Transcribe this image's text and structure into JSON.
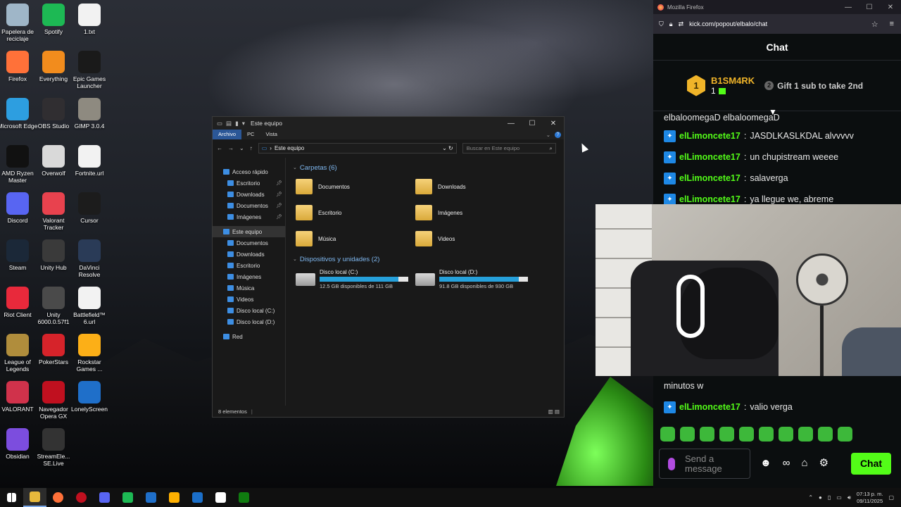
{
  "desktop": {
    "icons": [
      {
        "label": "Papelera de reciclaje",
        "icon": "recycle-bin-icon",
        "color": "#9fb6c8"
      },
      {
        "label": "Spotify",
        "icon": "spotify-icon",
        "color": "#1db954"
      },
      {
        "label": "1.txt",
        "icon": "text-file-icon",
        "color": "#f2f2f2"
      },
      {
        "label": "Firefox",
        "icon": "firefox-icon",
        "color": "#ff7139"
      },
      {
        "label": "Everything",
        "icon": "search-icon",
        "color": "#f28c1d"
      },
      {
        "label": "Epic Games Launcher",
        "icon": "epic-games-icon",
        "color": "#1a1a1a"
      },
      {
        "label": "Microsoft Edge",
        "icon": "edge-icon",
        "color": "#2d9ee0"
      },
      {
        "label": "OBS Studio",
        "icon": "obs-icon",
        "color": "#302e31"
      },
      {
        "label": "GIMP 3.0.4",
        "icon": "gimp-icon",
        "color": "#8e8a80"
      },
      {
        "label": "AMD Ryzen Master",
        "icon": "amd-ryzen-icon",
        "color": "#111111"
      },
      {
        "label": "Overwolf",
        "icon": "overwolf-icon",
        "color": "#d9d9d9"
      },
      {
        "label": "Fortnite.url",
        "icon": "url-file-icon",
        "color": "#f2f2f2"
      },
      {
        "label": "Discord",
        "icon": "discord-icon",
        "color": "#5865f2"
      },
      {
        "label": "Valorant Tracker",
        "icon": "valorant-tracker-icon",
        "color": "#e8424e"
      },
      {
        "label": "Cursor",
        "icon": "cursor-app-icon",
        "color": "#1c1c1c"
      },
      {
        "label": "Steam",
        "icon": "steam-icon",
        "color": "#1b2838"
      },
      {
        "label": "Unity Hub",
        "icon": "unity-hub-icon",
        "color": "#3a3a3a"
      },
      {
        "label": "DaVinci Resolve",
        "icon": "davinci-icon",
        "color": "#2a3b57"
      },
      {
        "label": "Riot Client",
        "icon": "riot-icon",
        "color": "#e8293b"
      },
      {
        "label": "Unity 6000.0.57f1",
        "icon": "unity-icon",
        "color": "#4a4a4a"
      },
      {
        "label": "Battlefield™ 6.url",
        "icon": "url-file-icon",
        "color": "#f2f2f2"
      },
      {
        "label": "League of Legends",
        "icon": "lol-icon",
        "color": "#b08d3c"
      },
      {
        "label": "PokerStars",
        "icon": "pokerstars-icon",
        "color": "#d6232a"
      },
      {
        "label": "Rockstar Games ...",
        "icon": "rockstar-icon",
        "color": "#fcaf17"
      },
      {
        "label": "VALORANT",
        "icon": "valorant-icon",
        "color": "#d0324b"
      },
      {
        "label": "Navegador Opera GX",
        "icon": "opera-gx-icon",
        "color": "#c0101f"
      },
      {
        "label": "LonelyScreen",
        "icon": "lonelyscreen-icon",
        "color": "#1f6fc9"
      },
      {
        "label": "Obsidian",
        "icon": "obsidian-icon",
        "color": "#7c4dde"
      },
      {
        "label": "StreamEle... SE.Live",
        "icon": "streamelements-icon",
        "color": "#333333"
      }
    ]
  },
  "explorer": {
    "title": "Este equipo",
    "ribbon_tabs": [
      "Archivo",
      "PC",
      "Vista"
    ],
    "address": "Este equipo",
    "search_placeholder": "Buscar en Este equipo",
    "nav": [
      {
        "label": "Acceso rápido",
        "level": 0,
        "pinned": false
      },
      {
        "label": "Escritorio",
        "level": 1,
        "pinned": true
      },
      {
        "label": "Downloads",
        "level": 1,
        "pinned": true
      },
      {
        "label": "Documentos",
        "level": 1,
        "pinned": true
      },
      {
        "label": "Imágenes",
        "level": 1,
        "pinned": true
      },
      {
        "label": "Este equipo",
        "level": 0,
        "pinned": false,
        "selected": true
      },
      {
        "label": "Documentos",
        "level": 1,
        "pinned": false
      },
      {
        "label": "Downloads",
        "level": 1,
        "pinned": false
      },
      {
        "label": "Escritorio",
        "level": 1,
        "pinned": false
      },
      {
        "label": "Imágenes",
        "level": 1,
        "pinned": false
      },
      {
        "label": "Música",
        "level": 1,
        "pinned": false
      },
      {
        "label": "Videos",
        "level": 1,
        "pinned": false
      },
      {
        "label": "Disco local (C:)",
        "level": 1,
        "pinned": false
      },
      {
        "label": "Disco local (D:)",
        "level": 1,
        "pinned": false
      },
      {
        "label": "Red",
        "level": 0,
        "pinned": false
      }
    ],
    "folders_header": "Carpetas (6)",
    "folders": [
      "Documentos",
      "Downloads",
      "Escritorio",
      "Imágenes",
      "Música",
      "Videos"
    ],
    "drives_header": "Dispositivos y unidades (2)",
    "drives": [
      {
        "name": "Disco local (C:)",
        "free": "12.5 GB disponibles de 111 GB",
        "used_fraction": 0.89
      },
      {
        "name": "Disco local (D:)",
        "free": "91.8 GB disponibles de 930 GB",
        "used_fraction": 0.9
      }
    ],
    "status": "8 elementos"
  },
  "firefox": {
    "title": "Mozilla Firefox",
    "url": "kick.com/popout/elbalo/chat",
    "chat_title": "Chat",
    "leaderboard": {
      "rank": "1",
      "user": "B1SM4RK",
      "count": "1",
      "gift_rank": "2",
      "gift_text": "Gift 1 sub to take 2nd"
    },
    "messages_top": [
      {
        "user": "",
        "text": "elbaloomegaD elbaloomegaD",
        "partial": true
      },
      {
        "user": "elLimoncete17",
        "text": "JASDLKASLKDAL alvvvvv"
      },
      {
        "user": "elLimoncete17",
        "text": "un chupistream weeee"
      },
      {
        "user": "elLimoncete17",
        "text": "salaverga"
      },
      {
        "user": "elLimoncete17",
        "text": "ya llegue we, abreme"
      }
    ],
    "messages_bottom": [
      {
        "user": "",
        "text": "minutos w"
      },
      {
        "user": "elLimoncete17",
        "text": "valio verga"
      }
    ],
    "input_placeholder": "Send a message",
    "send_label": "Chat",
    "accent": "#53fc18"
  },
  "taskbar": {
    "apps": [
      "file-explorer-icon",
      "firefox-icon",
      "opera-gx-icon",
      "discord-icon",
      "spotify-icon",
      "lonelyscreen-icon",
      "unity-icon",
      "steam-icon",
      "calculator-icon",
      "xbox-icon"
    ],
    "time": "07:13 p. m.",
    "date": "09/11/2025"
  }
}
